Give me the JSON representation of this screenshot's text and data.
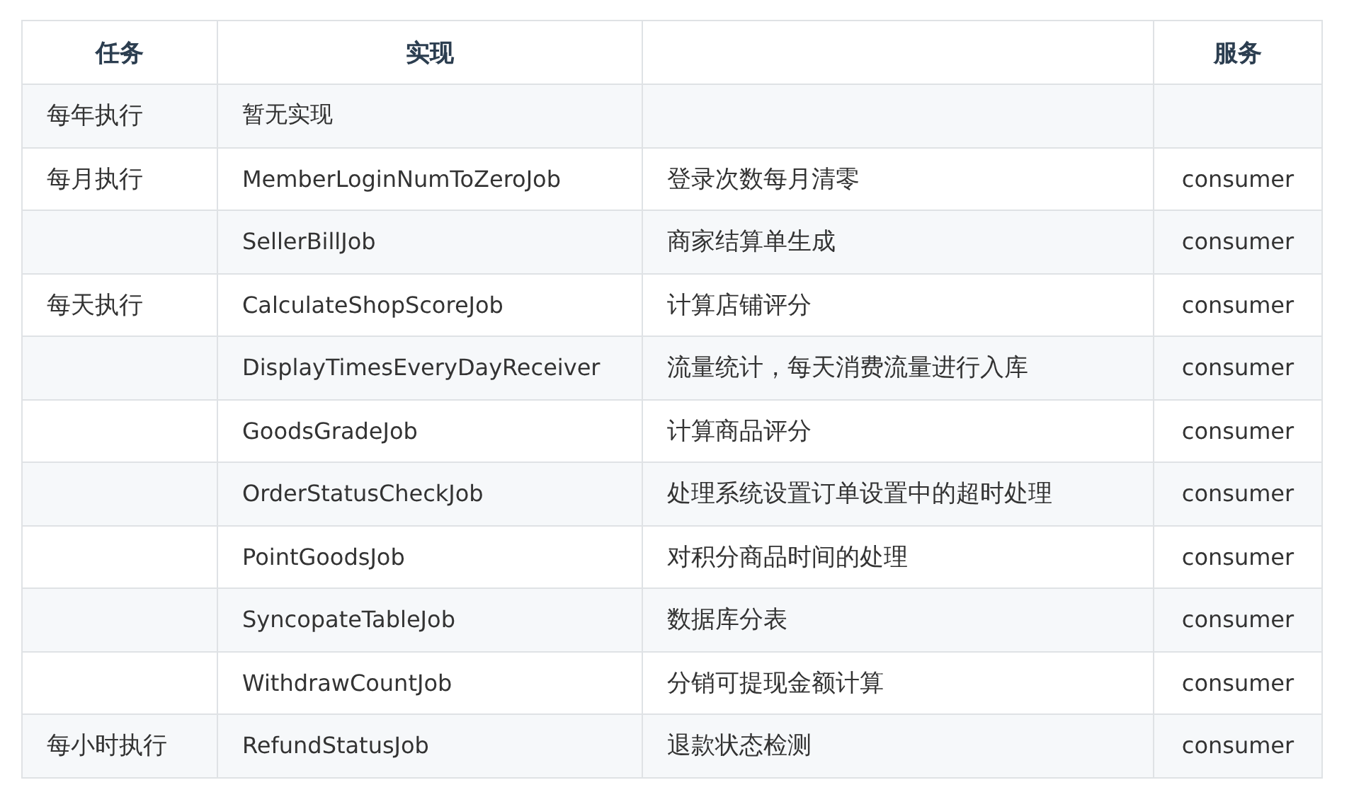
{
  "table": {
    "columns": [
      "任务",
      "实现",
      "",
      "服务"
    ],
    "rows": [
      {
        "task": "每年执行",
        "impl": "暂无实现",
        "desc": "",
        "service": ""
      },
      {
        "task": "每月执行",
        "impl": "MemberLoginNumToZeroJob",
        "desc": "登录次数每月清零",
        "service": "consumer"
      },
      {
        "task": "",
        "impl": "SellerBillJob",
        "desc": "商家结算单生成",
        "service": "consumer"
      },
      {
        "task": "每天执行",
        "impl": "CalculateShopScoreJob",
        "desc": "计算店铺评分",
        "service": "consumer"
      },
      {
        "task": "",
        "impl": "DisplayTimesEveryDayReceiver",
        "desc": "流量统计，每天消费流量进行入库",
        "service": "consumer"
      },
      {
        "task": "",
        "impl": "GoodsGradeJob",
        "desc": "计算商品评分",
        "service": "consumer"
      },
      {
        "task": "",
        "impl": "OrderStatusCheckJob",
        "desc": "处理系统设置订单设置中的超时处理",
        "service": "consumer"
      },
      {
        "task": "",
        "impl": "PointGoodsJob",
        "desc": "对积分商品时间的处理",
        "service": "consumer"
      },
      {
        "task": "",
        "impl": "SyncopateTableJob",
        "desc": "数据库分表",
        "service": "consumer"
      },
      {
        "task": "",
        "impl": "WithdrawCountJob",
        "desc": "分销可提现金额计算",
        "service": "consumer"
      },
      {
        "task": "每小时执行",
        "impl": "RefundStatusJob",
        "desc": "退款状态检测",
        "service": "consumer"
      }
    ]
  }
}
